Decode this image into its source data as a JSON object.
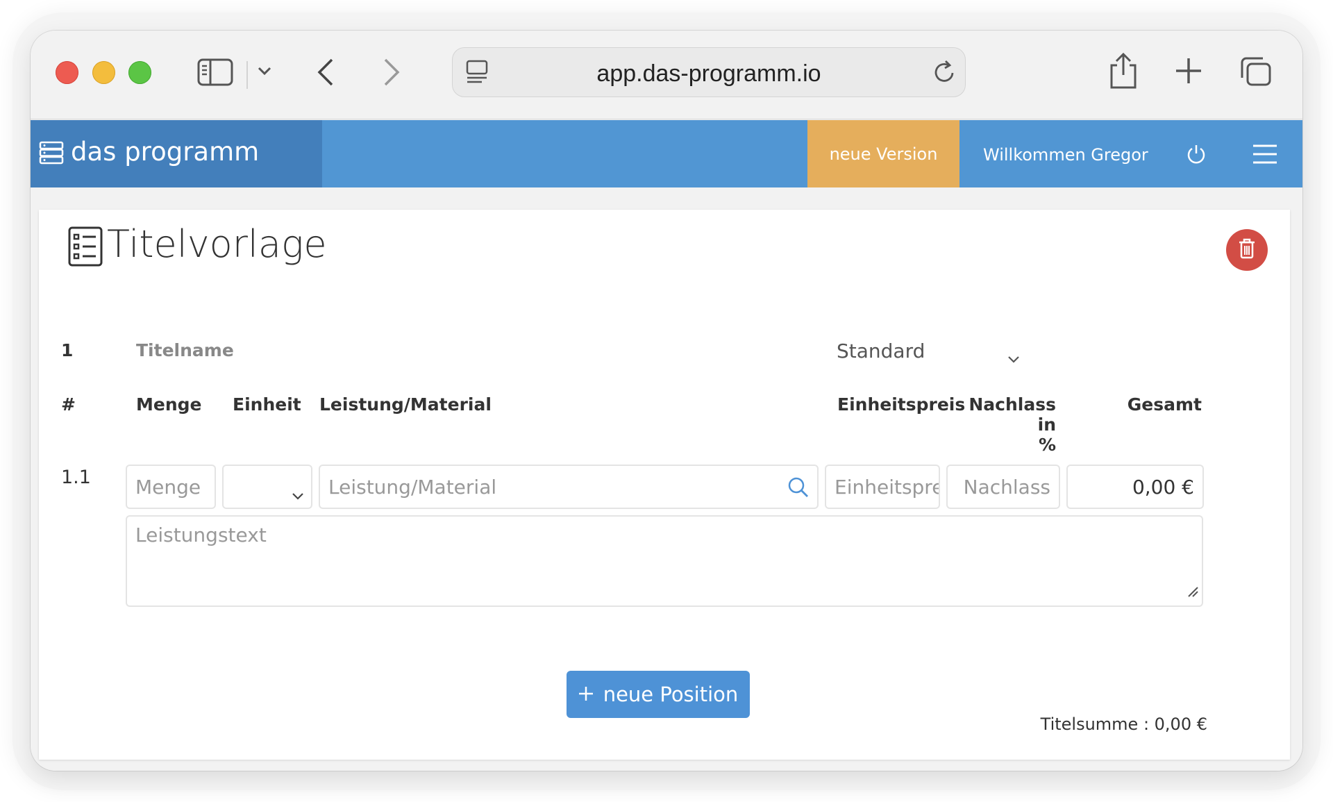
{
  "browser": {
    "url": "app.das-programm.io"
  },
  "appbar": {
    "brand": "das programm",
    "new_version": "neue Version",
    "welcome": "Willkommen Gregor"
  },
  "page": {
    "title": "Titelvorlage"
  },
  "title_row": {
    "number": "1",
    "name_placeholder": "Titelname",
    "type_selected": "Standard"
  },
  "table": {
    "headers": {
      "index": "#",
      "quantity": "Menge",
      "unit": "Einheit",
      "service": "Leistung/Material",
      "unit_price": "Einheitspreis",
      "discount_line1": "Nachlass in",
      "discount_line2": "%",
      "total": "Gesamt"
    },
    "rows": [
      {
        "index": "1.1",
        "quantity_placeholder": "Menge",
        "unit_value": "",
        "service_placeholder": "Leistung/Material",
        "unit_price_placeholder": "Einheitspre",
        "discount_placeholder": "Nachlass",
        "total": "0,00 €",
        "text_placeholder": "Leistungstext"
      }
    ]
  },
  "actions": {
    "add_position": "neue Position"
  },
  "footer": {
    "title_sum": "Titelsumme : 0,00 €"
  },
  "colors": {
    "appbar": "#5196d3",
    "brand_block": "#437fbb",
    "new_version": "#e5ae5c",
    "delete": "#d24d45",
    "primary_button": "#4e92d6"
  }
}
